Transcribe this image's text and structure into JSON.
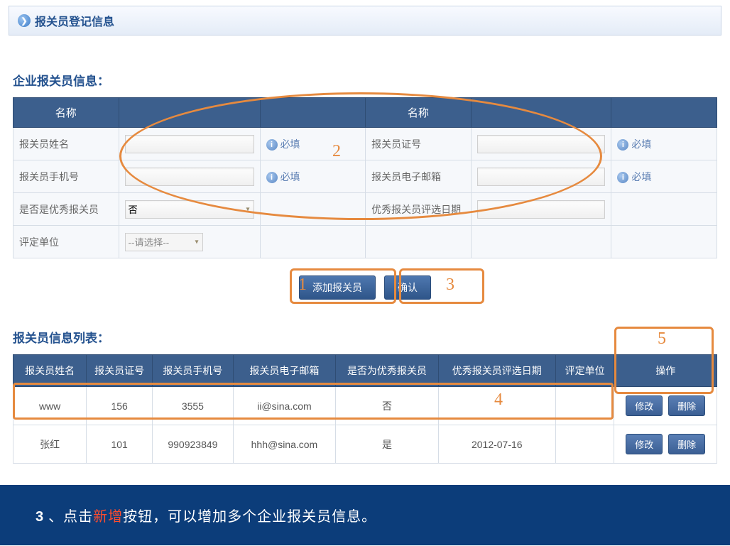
{
  "header": {
    "title": "报关员登记信息"
  },
  "form": {
    "section_title": "企业报关员信息：",
    "col1_header": "名称",
    "col2_header": "名称",
    "rows": [
      {
        "label_left": "报关员姓名",
        "hint_left": "必填",
        "label_right": "报关员证号",
        "hint_right": "必填"
      },
      {
        "label_left": "报关员手机号",
        "hint_left": "必填",
        "label_right": "报关员电子邮箱",
        "hint_right": "必填"
      },
      {
        "label_left": "是否是优秀报关员",
        "select_value": "否",
        "hint_left": "",
        "label_right": "优秀报关员评选日期",
        "hint_right": ""
      },
      {
        "label_left": "评定单位",
        "select_placeholder": "--请选择--",
        "hint_left": "",
        "label_right": "",
        "hint_right": ""
      }
    ]
  },
  "buttons": {
    "add": "添加报关员",
    "confirm": "确认",
    "edit": "修改",
    "delete": "删除"
  },
  "list": {
    "section_title": "报关员信息列表：",
    "headers": [
      "报关员姓名",
      "报关员证号",
      "报关员手机号",
      "报关员电子邮箱",
      "是否为优秀报关员",
      "优秀报关员评选日期",
      "评定单位",
      "操作"
    ],
    "rows": [
      {
        "name": "www",
        "id": "156",
        "phone": "3555",
        "email": "ii@sina.com",
        "excellent": "否",
        "date": "",
        "unit": ""
      },
      {
        "name": "张红",
        "id": "101",
        "phone": "990923849",
        "email": "hhh@sina.com",
        "excellent": "是",
        "date": "2012-07-16",
        "unit": ""
      }
    ]
  },
  "annotations": {
    "n1": "1",
    "n2": "2",
    "n3": "3",
    "n4": "4",
    "n5": "5"
  },
  "footer": {
    "num": "3",
    "sep": "、",
    "prefix": "点击",
    "highlight": "新增",
    "suffix": "按钮，可以增加多个企业报关员信息。"
  }
}
